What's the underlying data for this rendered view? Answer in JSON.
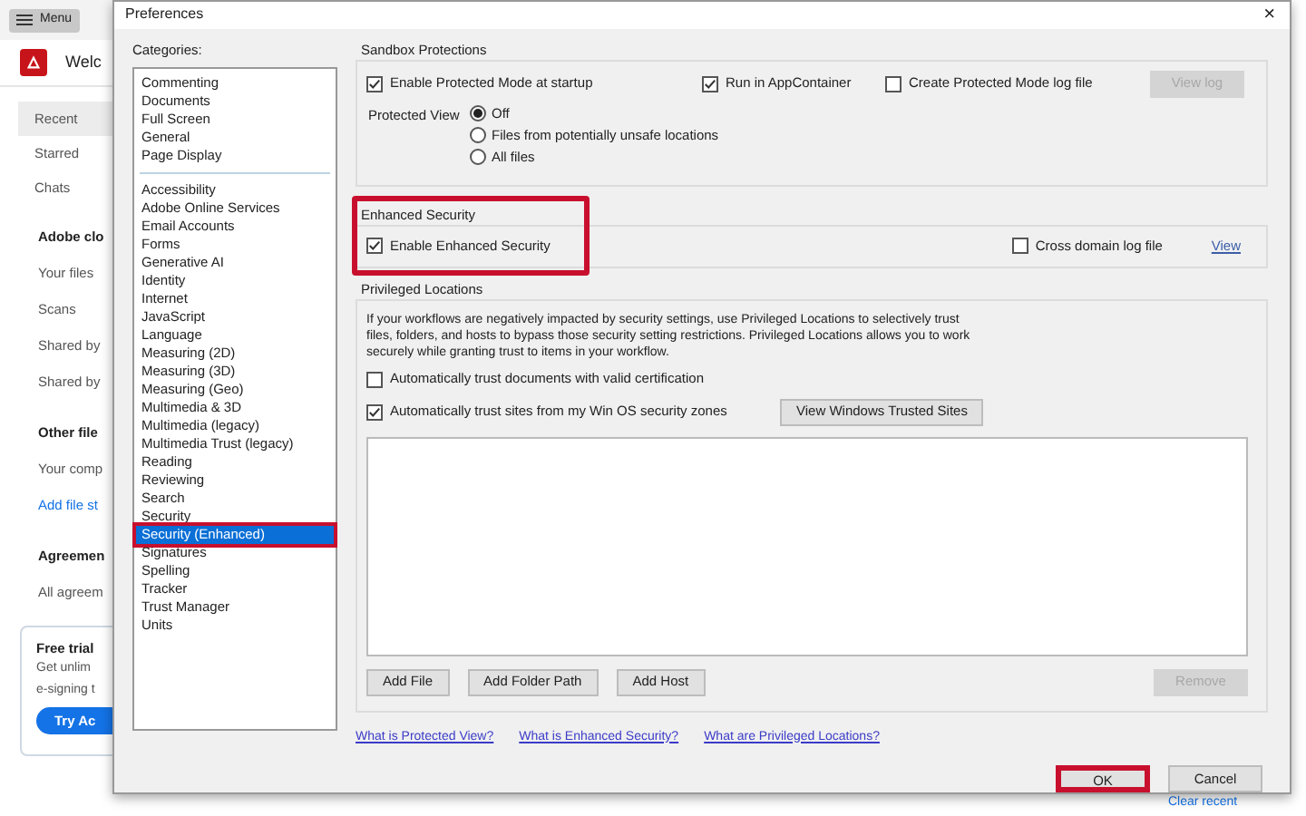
{
  "app": {
    "menu_button": "Menu",
    "welcome": "Welc",
    "nav": [
      {
        "label": "Recent",
        "selected": true
      },
      {
        "label": "Starred",
        "selected": false
      },
      {
        "label": "Chats",
        "selected": false
      }
    ],
    "sections": [
      {
        "heading": "Adobe clo",
        "items": [
          {
            "label": "Your files",
            "kind": "item"
          },
          {
            "label": "Scans",
            "kind": "item"
          },
          {
            "label": "Shared by",
            "kind": "item"
          },
          {
            "label": "Shared by",
            "kind": "item"
          }
        ]
      },
      {
        "heading": "Other file",
        "items": [
          {
            "label": "Your comp",
            "kind": "item"
          },
          {
            "label": "Add file st",
            "kind": "link"
          }
        ]
      },
      {
        "heading": "Agreemen",
        "items": [
          {
            "label": "All agreem",
            "kind": "item"
          }
        ]
      }
    ],
    "trial": {
      "title": "Free trial",
      "lines": [
        "Get unlim",
        "e-signing t"
      ],
      "button": "Try Ac"
    },
    "clear_recent": "Clear recent"
  },
  "dialog": {
    "title": "Preferences",
    "close": "×",
    "categories": {
      "label": "Categories:",
      "groups": [
        [
          {
            "label": "Commenting",
            "selected": false,
            "highlighted": false
          },
          {
            "label": "Documents",
            "selected": false,
            "highlighted": false
          },
          {
            "label": "Full Screen",
            "selected": false,
            "highlighted": false
          },
          {
            "label": "General",
            "selected": false,
            "highlighted": false
          },
          {
            "label": "Page Display",
            "selected": false,
            "highlighted": false
          }
        ],
        [
          {
            "label": "Accessibility",
            "selected": false,
            "highlighted": false
          },
          {
            "label": "Adobe Online Services",
            "selected": false,
            "highlighted": false
          },
          {
            "label": "Email Accounts",
            "selected": false,
            "highlighted": false
          },
          {
            "label": "Forms",
            "selected": false,
            "highlighted": false
          },
          {
            "label": "Generative AI",
            "selected": false,
            "highlighted": false
          },
          {
            "label": "Identity",
            "selected": false,
            "highlighted": false
          },
          {
            "label": "Internet",
            "selected": false,
            "highlighted": false
          },
          {
            "label": "JavaScript",
            "selected": false,
            "highlighted": false
          },
          {
            "label": "Language",
            "selected": false,
            "highlighted": false
          },
          {
            "label": "Measuring (2D)",
            "selected": false,
            "highlighted": false
          },
          {
            "label": "Measuring (3D)",
            "selected": false,
            "highlighted": false
          },
          {
            "label": "Measuring (Geo)",
            "selected": false,
            "highlighted": false
          },
          {
            "label": "Multimedia & 3D",
            "selected": false,
            "highlighted": false
          },
          {
            "label": "Multimedia (legacy)",
            "selected": false,
            "highlighted": false
          },
          {
            "label": "Multimedia Trust (legacy)",
            "selected": false,
            "highlighted": false
          },
          {
            "label": "Reading",
            "selected": false,
            "highlighted": false
          },
          {
            "label": "Reviewing",
            "selected": false,
            "highlighted": false
          },
          {
            "label": "Search",
            "selected": false,
            "highlighted": false
          },
          {
            "label": "Security",
            "selected": false,
            "highlighted": false
          },
          {
            "label": "Security (Enhanced)",
            "selected": true,
            "highlighted": true
          },
          {
            "label": "Signatures",
            "selected": false,
            "highlighted": false
          },
          {
            "label": "Spelling",
            "selected": false,
            "highlighted": false
          },
          {
            "label": "Tracker",
            "selected": false,
            "highlighted": false
          },
          {
            "label": "Trust Manager",
            "selected": false,
            "highlighted": false
          },
          {
            "label": "Units",
            "selected": false,
            "highlighted": false
          }
        ]
      ]
    },
    "sandbox": {
      "heading": "Sandbox Protections",
      "checkboxes": [
        {
          "label": "Enable Protected Mode at startup",
          "checked": true
        },
        {
          "label": "Run in AppContainer",
          "checked": true
        },
        {
          "label": "Create Protected Mode log file",
          "checked": false
        }
      ],
      "view_log": {
        "label": "View log",
        "disabled": true
      },
      "protected_view": {
        "label": "Protected View",
        "options": [
          {
            "label": "Off",
            "selected": true
          },
          {
            "label": "Files from potentially unsafe locations",
            "selected": false
          },
          {
            "label": "All files",
            "selected": false
          }
        ]
      }
    },
    "enhanced": {
      "heading": "Enhanced Security",
      "highlighted": true,
      "enable": {
        "label": "Enable Enhanced Security",
        "checked": true
      },
      "cross_domain": {
        "label": "Cross domain log file",
        "checked": false
      },
      "view": "View"
    },
    "privileged": {
      "heading": "Privileged Locations",
      "description": "If your workflows are negatively impacted by security settings, use Privileged Locations to selectively trust files, folders, and hosts to bypass those security setting restrictions. Privileged Locations allows you to work securely while granting trust to items in your workflow.",
      "checkboxes": [
        {
          "label": "Automatically trust documents with valid certification",
          "checked": false
        },
        {
          "label": "Automatically trust sites from my Win OS security zones",
          "checked": true
        }
      ],
      "trusted_sites_button": "View Windows Trusted Sites",
      "buttons": [
        {
          "label": "Add File",
          "disabled": false
        },
        {
          "label": "Add Folder Path",
          "disabled": false
        },
        {
          "label": "Add Host",
          "disabled": false
        }
      ],
      "remove": {
        "label": "Remove",
        "disabled": true
      }
    },
    "links": [
      "What is Protected View?",
      "What is Enhanced Security?",
      "What are Privileged Locations?"
    ],
    "ok": {
      "label": "OK",
      "highlighted": true
    },
    "cancel": {
      "label": "Cancel",
      "highlighted": false
    }
  }
}
